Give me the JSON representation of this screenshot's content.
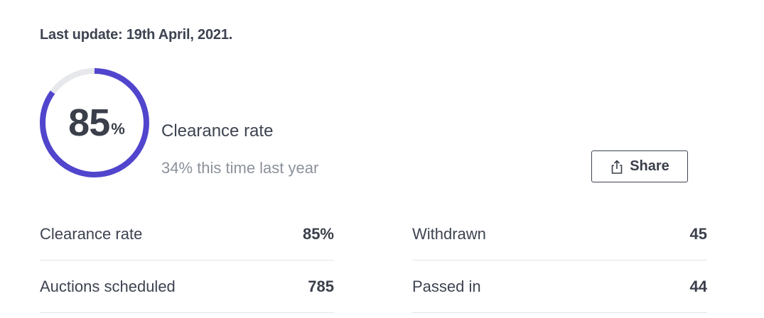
{
  "header": {
    "last_update": "Last update: 19th April, 2021."
  },
  "gauge": {
    "value": "85",
    "unit": "%",
    "progress_fraction": 0.85,
    "accent_color": "#5145cd",
    "track_color": "#e6e8ec"
  },
  "summary": {
    "title": "Clearance rate",
    "subtitle": "34% this time last year"
  },
  "share": {
    "label": "Share",
    "icon": "share-icon"
  },
  "stats": {
    "left": [
      {
        "label": "Clearance rate",
        "value": "85%"
      },
      {
        "label": "Auctions scheduled",
        "value": "785"
      }
    ],
    "right": [
      {
        "label": "Withdrawn",
        "value": "45"
      },
      {
        "label": "Passed in",
        "value": "44"
      }
    ]
  }
}
